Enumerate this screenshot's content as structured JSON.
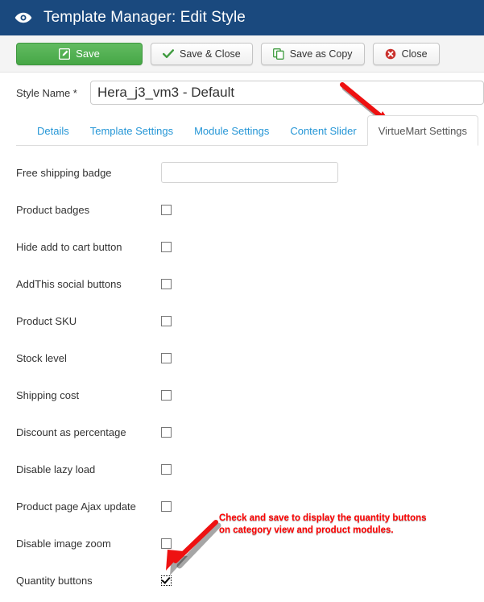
{
  "header": {
    "icon": "eye-icon",
    "title": "Template Manager: Edit Style",
    "background_color": "#1a497e"
  },
  "toolbar": {
    "buttons": [
      {
        "label": "Save",
        "icon": "pencil-square-icon",
        "style": "primary-green",
        "color": "#46a746"
      },
      {
        "label": "Save & Close",
        "icon": "check-icon",
        "style": "default",
        "color": "#46a746"
      },
      {
        "label": "Save as Copy",
        "icon": "copy-icon",
        "style": "default",
        "color": "#46a746"
      },
      {
        "label": "Close",
        "icon": "close-circle-icon",
        "style": "default",
        "color": "#c9302c"
      }
    ]
  },
  "style_name": {
    "label": "Style Name *",
    "value": "Hera_j3_vm3 - Default",
    "placeholder": ""
  },
  "tabs": [
    {
      "label": "Details",
      "active": false
    },
    {
      "label": "Template Settings",
      "active": false
    },
    {
      "label": "Module Settings",
      "active": false
    },
    {
      "label": "Content Slider",
      "active": false
    },
    {
      "label": "VirtueMart Settings",
      "active": true
    }
  ],
  "settings": [
    {
      "label": "Free shipping badge",
      "type": "text",
      "value": "",
      "placeholder": ""
    },
    {
      "label": "Product badges",
      "type": "checkbox",
      "checked": false
    },
    {
      "label": "Hide add to cart button",
      "type": "checkbox",
      "checked": false
    },
    {
      "label": "AddThis social buttons",
      "type": "checkbox",
      "checked": false
    },
    {
      "label": "Product SKU",
      "type": "checkbox",
      "checked": false
    },
    {
      "label": "Stock level",
      "type": "checkbox",
      "checked": false
    },
    {
      "label": "Shipping cost",
      "type": "checkbox",
      "checked": false
    },
    {
      "label": "Discount as percentage",
      "type": "checkbox",
      "checked": false
    },
    {
      "label": "Disable lazy load",
      "type": "checkbox",
      "checked": false
    },
    {
      "label": "Product page Ajax update",
      "type": "checkbox",
      "checked": false
    },
    {
      "label": "Disable image zoom",
      "type": "checkbox",
      "checked": false
    },
    {
      "label": "Quantity buttons",
      "type": "checkbox",
      "checked": true
    }
  ],
  "annotations": {
    "color": "#ff0000",
    "tab_arrow": {
      "name": "arrow-to-virtuemart-tab"
    },
    "checkbox_arrow": {
      "name": "arrow-to-quantity-buttons-checkbox"
    },
    "note_text": "Check and save to display the quantity buttons\non category view and product modules."
  }
}
